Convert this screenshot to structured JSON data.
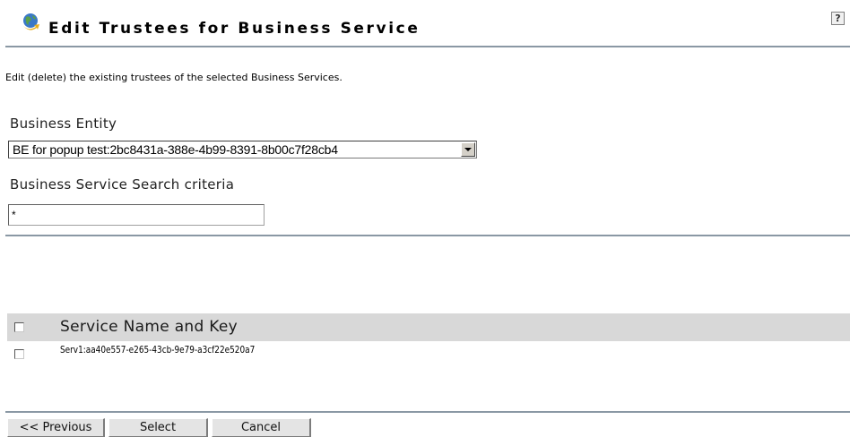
{
  "header": {
    "title": "Edit Trustees for Business Service",
    "logo_icon": "globe-arrow-icon",
    "help_label": "?"
  },
  "description": "Edit (delete) the existing trustees of the selected Business Services.",
  "business_entity": {
    "label": "Business Entity",
    "selected_value": "BE for popup test:2bc8431a-388e-4b99-8391-8b00c7f28cb4"
  },
  "search": {
    "label": "Business Service Search criteria",
    "value": "*"
  },
  "table": {
    "column_header": "Service Name and Key",
    "rows": [
      {
        "text": "Serv1:aa40e557-e265-43cb-9e79-a3cf22e520a7",
        "checked": false
      }
    ]
  },
  "buttons": {
    "previous": "<< Previous",
    "select": "Select",
    "cancel": "Cancel"
  },
  "colors": {
    "rule": "#8a98a4",
    "table_header_bg": "#d8d8d8",
    "button_bg": "#e4e4e4"
  }
}
